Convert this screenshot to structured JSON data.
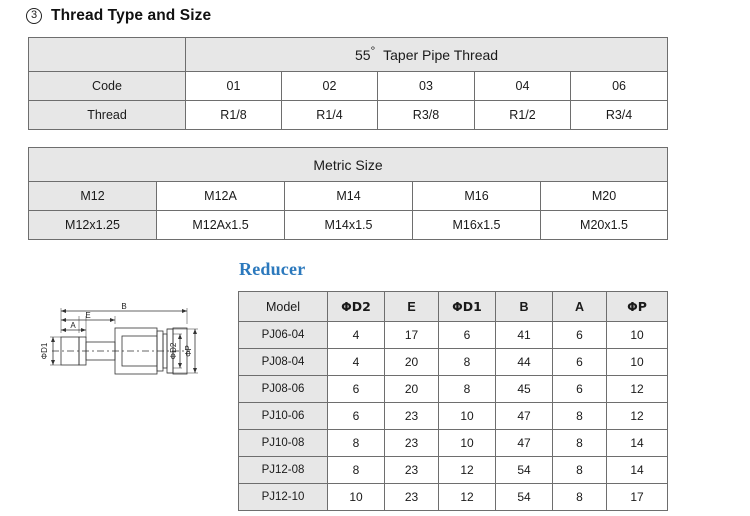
{
  "section": {
    "number": "3",
    "title": "Thread Type and Size"
  },
  "thread_table": {
    "corner_label": "",
    "group_header": "Taper Pipe Thread",
    "group_header_angle": "55",
    "group_header_degree": "°",
    "rows": [
      {
        "label": "Code",
        "values": [
          "01",
          "02",
          "03",
          "04",
          "06"
        ]
      },
      {
        "label": "Thread",
        "values": [
          "R1/8",
          "R1/4",
          "R3/8",
          "R1/2",
          "R3/4"
        ]
      }
    ]
  },
  "metric_table": {
    "group_header": "Metric Size",
    "rows": [
      {
        "values": [
          "M12",
          "M12A",
          "M14",
          "M16",
          "M20"
        ]
      },
      {
        "values": [
          "M12x1.25",
          "M12Ax1.5",
          "M14x1.5",
          "M16x1.5",
          "M20x1.5"
        ]
      }
    ]
  },
  "reducer": {
    "heading": "Reducer",
    "columns": [
      "Model",
      "ΦD2",
      "E",
      "ΦD1",
      "B",
      "A",
      "ΦP"
    ],
    "rows": [
      [
        "PJ06-04",
        "4",
        "17",
        "6",
        "41",
        "6",
        "10"
      ],
      [
        "PJ08-04",
        "4",
        "20",
        "8",
        "44",
        "6",
        "10"
      ],
      [
        "PJ08-06",
        "6",
        "20",
        "8",
        "45",
        "6",
        "12"
      ],
      [
        "PJ10-06",
        "6",
        "23",
        "10",
        "47",
        "8",
        "12"
      ],
      [
        "PJ10-08",
        "8",
        "23",
        "10",
        "47",
        "8",
        "14"
      ],
      [
        "PJ12-08",
        "8",
        "23",
        "12",
        "54",
        "8",
        "14"
      ],
      [
        "PJ12-10",
        "10",
        "23",
        "12",
        "54",
        "8",
        "17"
      ]
    ]
  },
  "drawing": {
    "labels": {
      "b": "B",
      "e": "E",
      "a": "A",
      "d1": "ΦD1",
      "d2": "ΦD2",
      "p": "ΦP"
    }
  },
  "colors": {
    "header_fill": "#e7e7e7",
    "border": "#6e6e6e",
    "accent_blue": "#2c79bd",
    "text": "#1a1a1a"
  }
}
